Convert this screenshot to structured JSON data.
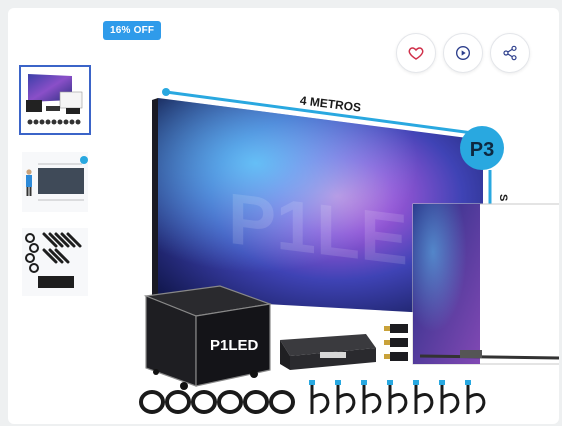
{
  "badge": {
    "text": "16% OFF",
    "color": "#2f9bea"
  },
  "actions": [
    {
      "name": "wishlist-button",
      "icon": "heart-icon",
      "color": "#d0304a"
    },
    {
      "name": "video-button",
      "icon": "play-circle-icon",
      "color": "#2c3e8c"
    },
    {
      "name": "share-button",
      "icon": "share-icon",
      "color": "#2c3e8c"
    }
  ],
  "thumbnails": [
    {
      "name": "thumbnail-1",
      "active": true
    },
    {
      "name": "thumbnail-2",
      "active": false
    },
    {
      "name": "thumbnail-3",
      "active": false
    }
  ],
  "product_image": {
    "width_label": "4 METROS",
    "pitch_badge": "P3",
    "height_label_partial": "S",
    "screen_watermark": "P1LED",
    "case_logo": "P1LED",
    "accent_color": "#29a8e0"
  }
}
